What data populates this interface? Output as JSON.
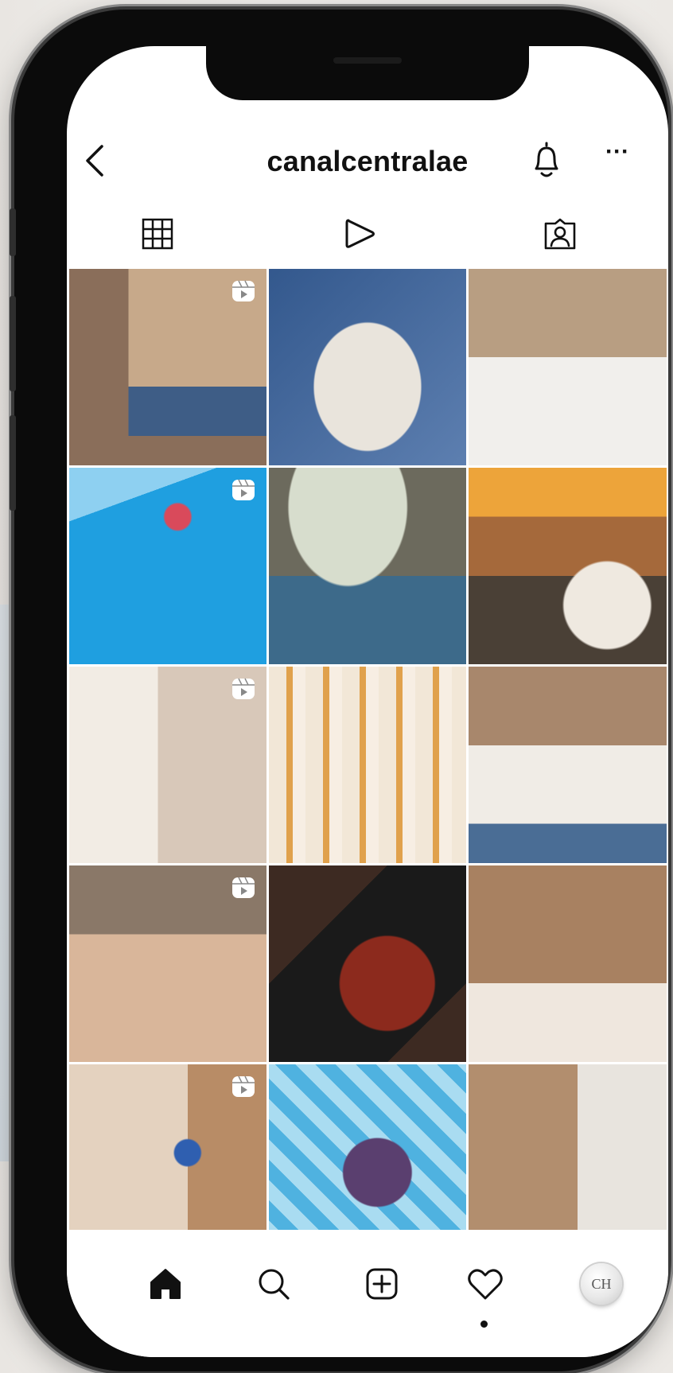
{
  "profile": {
    "username": "canalcentralae",
    "avatar_monogram": "CH"
  },
  "header": {
    "back_icon": "chevron-left-icon",
    "bell_icon": "bell-icon",
    "more_label": "···"
  },
  "tabs": [
    {
      "name": "grid",
      "icon": "grid-icon"
    },
    {
      "name": "reels",
      "icon": "play-icon"
    },
    {
      "name": "tagged",
      "icon": "tagged-person-icon"
    }
  ],
  "posts": [
    {
      "subject": "hotel room with blue sofa and tall wooden wall art",
      "reel": true,
      "palette": [
        "#8a6e5a",
        "#c7a98a",
        "#3e5d86"
      ]
    },
    {
      "subject": "fruit platter with orchids on round marble table",
      "reel": false,
      "palette": [
        "#33588d",
        "#e9e4dc",
        "#c6452f"
      ]
    },
    {
      "subject": "woman in white bathrobe on bed with coffee",
      "reel": false,
      "palette": [
        "#b89e82",
        "#f1efec",
        "#52739b"
      ]
    },
    {
      "subject": "blue cocktail with raspberries by the pool",
      "reel": true,
      "palette": [
        "#1f9fe0",
        "#8ed0f1",
        "#d94a5b"
      ]
    },
    {
      "subject": "restaurant terrace under blossom tree",
      "reel": false,
      "palette": [
        "#6c6a5d",
        "#d7ddcd",
        "#3d6a8a"
      ]
    },
    {
      "subject": "orange juice and croissants breakfast",
      "reel": false,
      "palette": [
        "#a5693b",
        "#eda43a",
        "#4a4036"
      ]
    },
    {
      "subject": "woman in bathrobe at desk with fruit",
      "reel": true,
      "palette": [
        "#d8c8b9",
        "#f2ece4",
        "#6b4b3a"
      ]
    },
    {
      "subject": "golden tree branch wall pattern",
      "reel": false,
      "palette": [
        "#f2e7d7",
        "#e0a14c",
        "#f7eee3"
      ]
    },
    {
      "subject": "woman reading menu in bed",
      "reel": false,
      "palette": [
        "#a8876c",
        "#f0ece6",
        "#4a6d95"
      ]
    },
    {
      "subject": "wooden mosaic wall decor with rings",
      "reel": true,
      "palette": [
        "#d9b69a",
        "#e7cbb4",
        "#8a7868"
      ]
    },
    {
      "subject": "glazed chicken wings on black slate",
      "reel": false,
      "palette": [
        "#3d2a22",
        "#8c2a1d",
        "#1a1a1a"
      ]
    },
    {
      "subject": "hotel room with lamp and glass bathroom",
      "reel": false,
      "palette": [
        "#a88161",
        "#efe7de",
        "#5b7ea3"
      ]
    },
    {
      "subject": "blue flower vase against wooden wall",
      "reel": true,
      "palette": [
        "#e4d2bf",
        "#2f5fb0",
        "#b88c66"
      ]
    },
    {
      "subject": "berry drink over pool tiles",
      "reel": false,
      "palette": [
        "#4fb2e0",
        "#a9dcf1",
        "#5a3f6f"
      ]
    },
    {
      "subject": "living room with blue armchair and city window",
      "reel": false,
      "palette": [
        "#b28e6e",
        "#e8e4de",
        "#3d6996"
      ]
    }
  ],
  "bottom_nav": [
    {
      "name": "home",
      "icon": "home-icon"
    },
    {
      "name": "search",
      "icon": "search-icon"
    },
    {
      "name": "new-post",
      "icon": "plus-square-icon"
    },
    {
      "name": "activity",
      "icon": "heart-icon"
    },
    {
      "name": "profile",
      "icon": "avatar"
    }
  ]
}
